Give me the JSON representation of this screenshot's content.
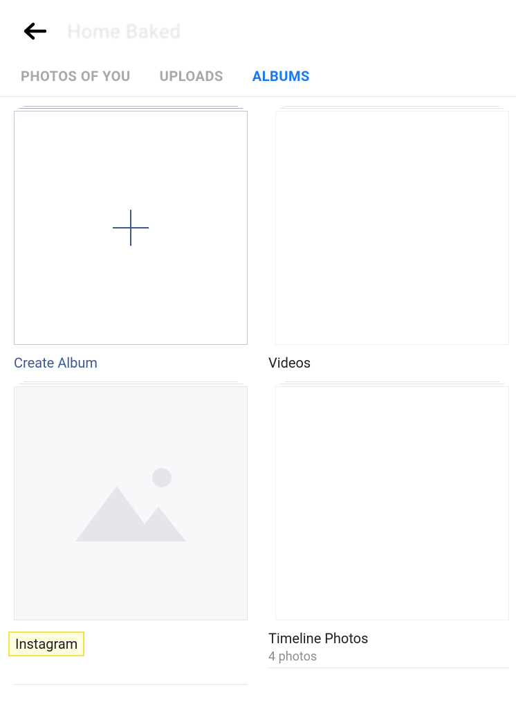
{
  "header": {
    "title": "Home Baked"
  },
  "tabs": {
    "photos_of_you": "PHOTOS OF YOU",
    "uploads": "UPLOADS",
    "albums": "ALBUMS"
  },
  "albums": {
    "create_label": "Create Album",
    "videos_label": "Videos",
    "instagram_label": "Instagram",
    "timeline_label": "Timeline Photos",
    "timeline_count": "4 photos"
  }
}
